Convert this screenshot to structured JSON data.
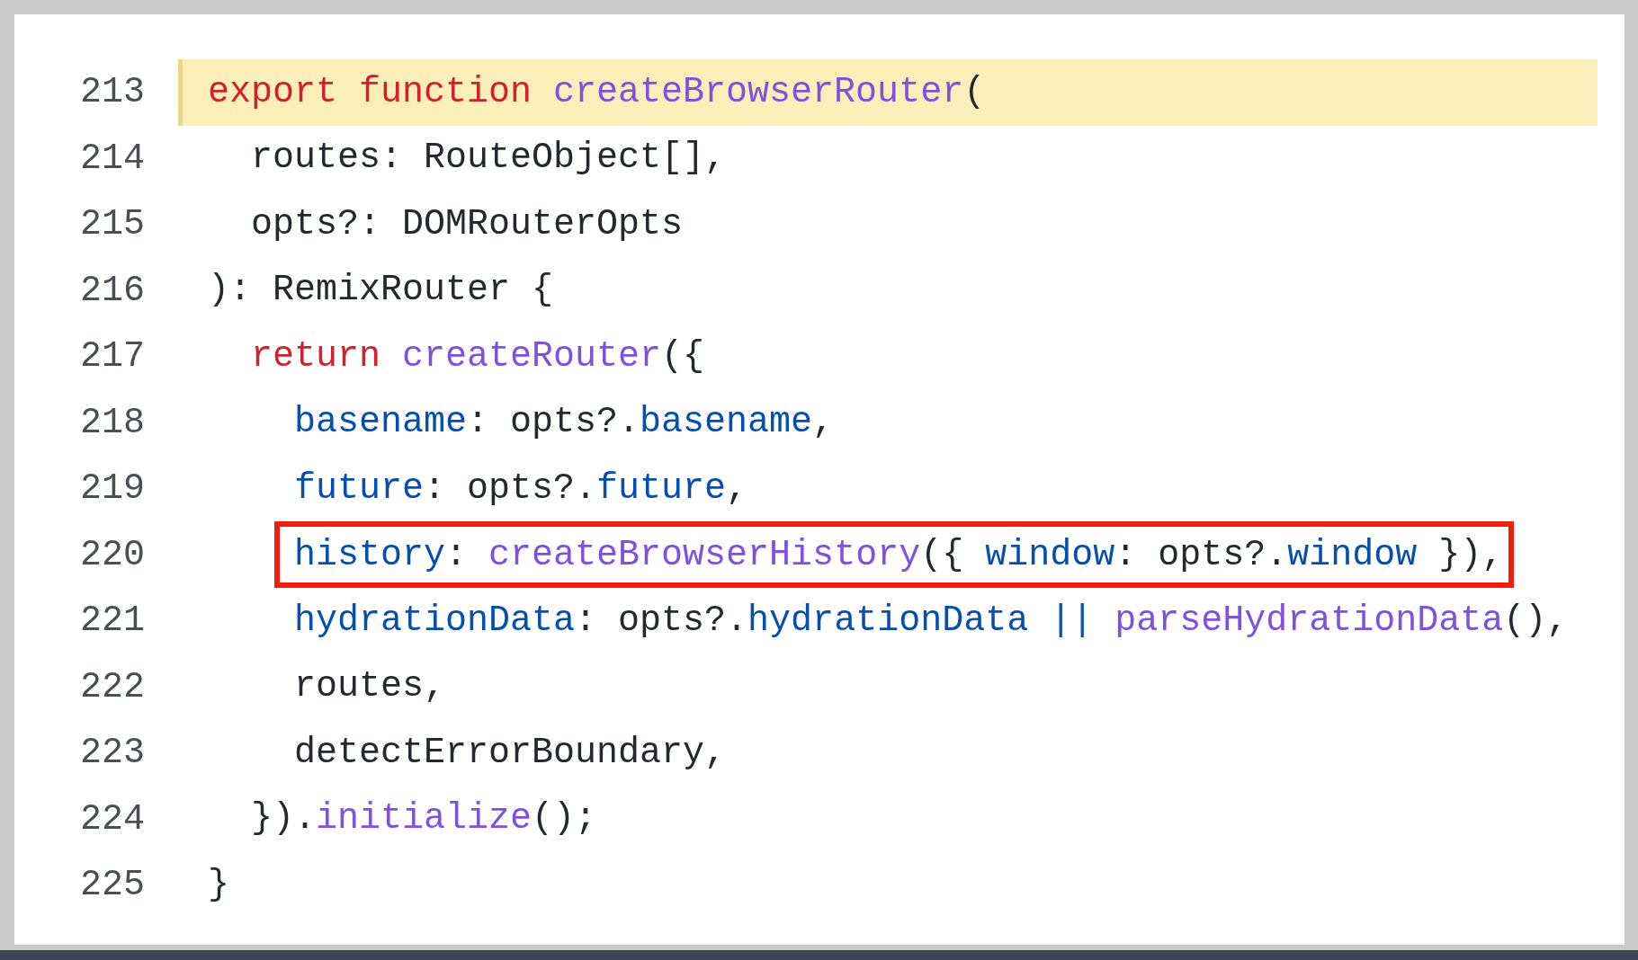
{
  "code_lines": [
    {
      "number": "213",
      "highlighted": true,
      "boxed": false,
      "tokens": [
        {
          "text": "export function ",
          "kind": "keyword"
        },
        {
          "text": "createBrowserRouter",
          "kind": "function"
        },
        {
          "text": "(",
          "kind": "plain"
        }
      ]
    },
    {
      "number": "214",
      "highlighted": false,
      "boxed": false,
      "tokens": [
        {
          "text": "  routes: RouteObject[],",
          "kind": "plain"
        }
      ]
    },
    {
      "number": "215",
      "highlighted": false,
      "boxed": false,
      "tokens": [
        {
          "text": "  opts?: DOMRouterOpts",
          "kind": "plain"
        }
      ]
    },
    {
      "number": "216",
      "highlighted": false,
      "boxed": false,
      "tokens": [
        {
          "text": "): RemixRouter {",
          "kind": "plain"
        }
      ]
    },
    {
      "number": "217",
      "highlighted": false,
      "boxed": false,
      "tokens": [
        {
          "text": "  return ",
          "kind": "keyword"
        },
        {
          "text": "createRouter",
          "kind": "function"
        },
        {
          "text": "({",
          "kind": "plain"
        }
      ]
    },
    {
      "number": "218",
      "highlighted": false,
      "boxed": false,
      "tokens": [
        {
          "text": "    basename",
          "kind": "property"
        },
        {
          "text": ": opts?.",
          "kind": "plain"
        },
        {
          "text": "basename",
          "kind": "property"
        },
        {
          "text": ",",
          "kind": "plain"
        }
      ]
    },
    {
      "number": "219",
      "highlighted": false,
      "boxed": false,
      "tokens": [
        {
          "text": "    future",
          "kind": "property"
        },
        {
          "text": ": opts?.",
          "kind": "plain"
        },
        {
          "text": "future",
          "kind": "property"
        },
        {
          "text": ",",
          "kind": "plain"
        }
      ]
    },
    {
      "number": "220",
      "highlighted": false,
      "boxed": true,
      "tokens": [
        {
          "text": "    history",
          "kind": "property"
        },
        {
          "text": ": ",
          "kind": "plain"
        },
        {
          "text": "createBrowserHistory",
          "kind": "function"
        },
        {
          "text": "({ ",
          "kind": "plain"
        },
        {
          "text": "window",
          "kind": "property"
        },
        {
          "text": ": opts?.",
          "kind": "plain"
        },
        {
          "text": "window",
          "kind": "property"
        },
        {
          "text": " }),",
          "kind": "plain"
        }
      ]
    },
    {
      "number": "221",
      "highlighted": false,
      "boxed": false,
      "tokens": [
        {
          "text": "    hydrationData",
          "kind": "property"
        },
        {
          "text": ": opts?.",
          "kind": "plain"
        },
        {
          "text": "hydrationData",
          "kind": "property"
        },
        {
          "text": " || ",
          "kind": "property"
        },
        {
          "text": "parseHydrationData",
          "kind": "function"
        },
        {
          "text": "(),",
          "kind": "plain"
        }
      ]
    },
    {
      "number": "222",
      "highlighted": false,
      "boxed": false,
      "tokens": [
        {
          "text": "    routes,",
          "kind": "plain"
        }
      ]
    },
    {
      "number": "223",
      "highlighted": false,
      "boxed": false,
      "tokens": [
        {
          "text": "    detectErrorBoundary,",
          "kind": "plain"
        }
      ]
    },
    {
      "number": "224",
      "highlighted": false,
      "boxed": false,
      "tokens": [
        {
          "text": "  }).",
          "kind": "plain"
        },
        {
          "text": "initialize",
          "kind": "function"
        },
        {
          "text": "();",
          "kind": "plain"
        }
      ]
    },
    {
      "number": "225",
      "highlighted": false,
      "boxed": false,
      "tokens": [
        {
          "text": "}",
          "kind": "plain"
        }
      ]
    }
  ]
}
